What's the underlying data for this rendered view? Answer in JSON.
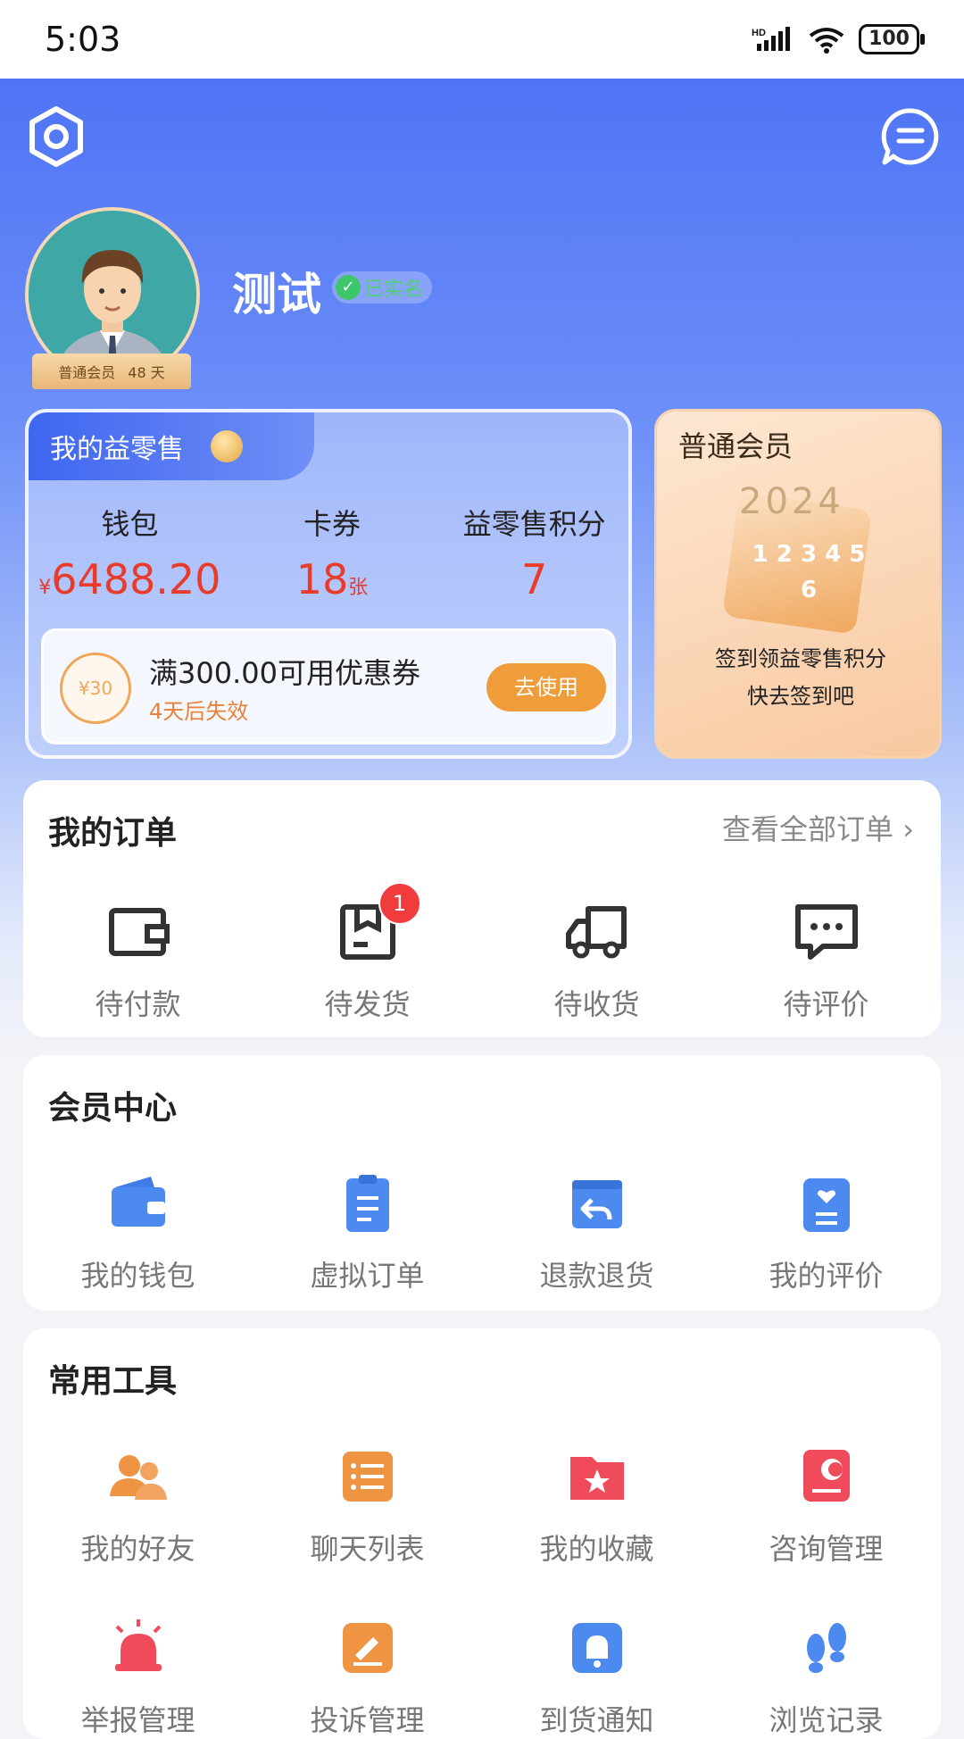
{
  "status_bar": {
    "time": "5:03",
    "battery": "100",
    "signal_label": "HD"
  },
  "header": {
    "settings_icon": "settings-hex-icon",
    "message_icon": "chat-bubble-icon"
  },
  "profile": {
    "name": "测试",
    "verified_label": "已实名",
    "member_level": "普通会员",
    "member_days": "48 天"
  },
  "wallet_card": {
    "title": "我的益零售",
    "stats": [
      {
        "label": "钱包",
        "currency": "¥",
        "value": "6488.20",
        "unit": ""
      },
      {
        "label": "卡券",
        "currency": "",
        "value": "18",
        "unit": "张"
      },
      {
        "label": "益零售积分",
        "currency": "",
        "value": "7",
        "unit": ""
      }
    ],
    "coupon": {
      "icon_text": "¥30",
      "title": "满300.00可用优惠券",
      "subtitle": "4天后失效",
      "button": "去使用"
    }
  },
  "member_card": {
    "title": "普通会员",
    "calendar_year": "2024",
    "calendar_nums": "1 2 3 4 5 6",
    "desc_line1": "签到领益零售积分",
    "desc_line2": "快去签到吧"
  },
  "orders": {
    "title": "我的订单",
    "view_all": "查看全部订单 ›",
    "items": [
      {
        "label": "待付款",
        "icon": "wallet-outline-icon",
        "badge": ""
      },
      {
        "label": "待发货",
        "icon": "box-outline-icon",
        "badge": "1"
      },
      {
        "label": "待收货",
        "icon": "truck-outline-icon",
        "badge": ""
      },
      {
        "label": "待评价",
        "icon": "comment-outline-icon",
        "badge": ""
      }
    ]
  },
  "member_center": {
    "title": "会员中心",
    "items": [
      {
        "label": "我的钱包",
        "icon": "wallet-icon"
      },
      {
        "label": "虚拟订单",
        "icon": "clipboard-icon"
      },
      {
        "label": "退款退货",
        "icon": "refund-icon"
      },
      {
        "label": "我的评价",
        "icon": "heart-card-icon"
      }
    ]
  },
  "tools": {
    "title": "常用工具",
    "items": [
      {
        "label": "我的好友",
        "icon": "friends-icon"
      },
      {
        "label": "聊天列表",
        "icon": "list-icon"
      },
      {
        "label": "我的收藏",
        "icon": "star-folder-icon"
      },
      {
        "label": "咨询管理",
        "icon": "consult-icon"
      },
      {
        "label": "举报管理",
        "icon": "alarm-icon"
      },
      {
        "label": "投诉管理",
        "icon": "complaint-icon"
      },
      {
        "label": "到货通知",
        "icon": "bell-icon"
      },
      {
        "label": "浏览记录",
        "icon": "footprint-icon"
      }
    ]
  },
  "colors": {
    "accent_blue": "#4f74f5",
    "price_red": "#e83b2a",
    "orange": "#ef9c3a"
  }
}
